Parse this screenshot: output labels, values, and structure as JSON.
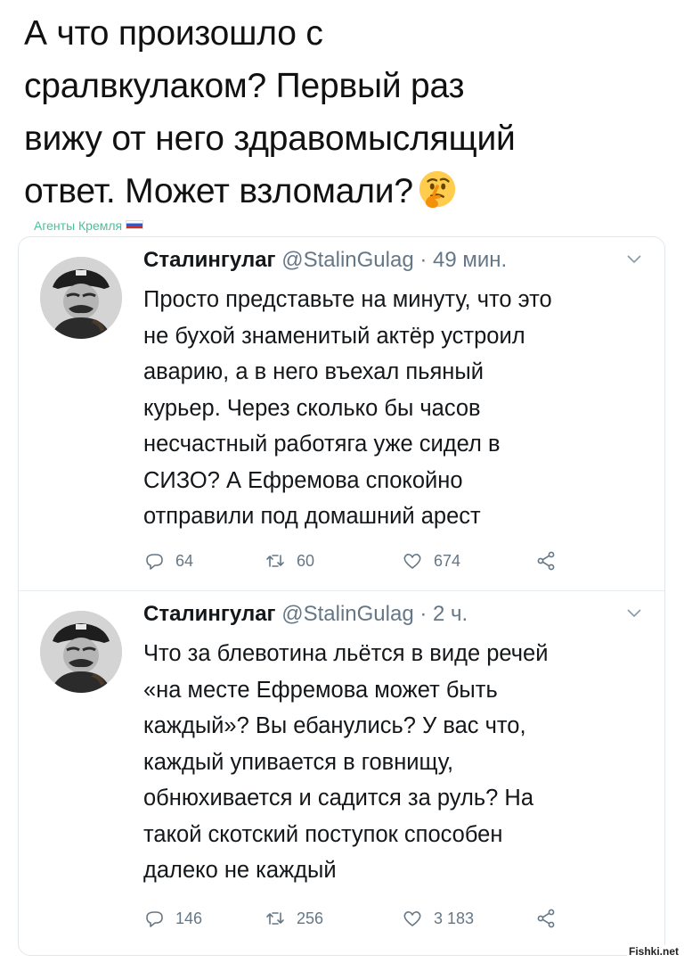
{
  "post": {
    "header_lines": [
      "А что произошло с",
      "сралвкулаком? Первый раз",
      "вижу от него здравомыслящий",
      "ответ. Может взломали?"
    ],
    "emoji": "thinking-face-icon",
    "channel_tag": "Агенты Кремля"
  },
  "tweets": [
    {
      "author_name": "Сталингулаг",
      "handle": "@StalinGulag",
      "separator": "·",
      "time": "49 мин.",
      "text_lines": [
        "Просто представьте на минуту, что это",
        "не бухой знаменитый актёр устроил",
        "аварию, а в него въехал пьяный",
        "курьер. Через сколько бы часов",
        "несчастный работяга уже сидел в",
        "СИЗО? А Ефремова спокойно",
        "отправили под домашний арест"
      ],
      "replies": "64",
      "retweets": "60",
      "likes": "674"
    },
    {
      "author_name": "Сталингулаг",
      "handle": "@StalinGulag",
      "separator": "·",
      "time": "2 ч.",
      "text_lines": [
        "Что за блевотина льётся в виде речей",
        "«на месте Ефремова может быть",
        "каждый»? Вы ебанулись? У вас что,",
        "каждый упивается в говнищу,",
        "обнюхивается и садится за руль? На",
        "такой скотский поступок способен",
        "далеко не каждый"
      ],
      "replies": "146",
      "retweets": "256",
      "likes": "3 183"
    }
  ],
  "watermark": "Fishki.net",
  "colors": {
    "channel_tag": "#49c29a",
    "secondary_text": "#657786",
    "border": "#e1e8ed"
  }
}
